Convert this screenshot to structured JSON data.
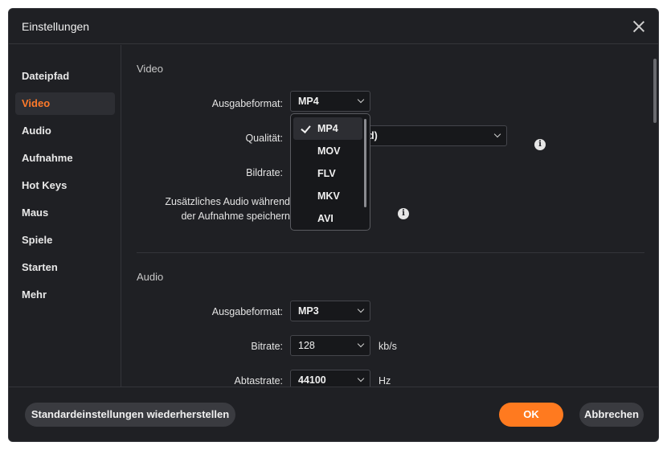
{
  "window": {
    "title": "Einstellungen"
  },
  "sidebar": {
    "items": [
      {
        "label": "Dateipfad",
        "active": false
      },
      {
        "label": "Video",
        "active": true
      },
      {
        "label": "Audio",
        "active": false
      },
      {
        "label": "Aufnahme",
        "active": false
      },
      {
        "label": "Hot Keys",
        "active": false
      },
      {
        "label": "Maus",
        "active": false
      },
      {
        "label": "Spiele",
        "active": false
      },
      {
        "label": "Starten",
        "active": false
      },
      {
        "label": "Mehr",
        "active": false
      }
    ]
  },
  "video": {
    "section_title": "Video",
    "output_format_label": "Ausgabeformat:",
    "output_format_value": "MP4",
    "quality_label": "Qualität:",
    "quality_value_visible": "d)",
    "bitrate_label": "Bildrate:",
    "extra_audio_label_line1": "Zusätzliches Audio während",
    "extra_audio_label_line2": "der Aufnahme speichern",
    "info_glyph": "i"
  },
  "format_dropdown": {
    "options": [
      "MP4",
      "MOV",
      "FLV",
      "MKV",
      "AVI"
    ],
    "selected": "MP4"
  },
  "audio": {
    "section_title": "Audio",
    "output_format_label": "Ausgabeformat:",
    "output_format_value": "MP3",
    "bitrate_label": "Bitrate:",
    "bitrate_value": "128",
    "bitrate_unit": "kb/s",
    "samplerate_label": "Abtastrate:",
    "samplerate_value": "44100",
    "samplerate_unit": "Hz"
  },
  "footer": {
    "reset_label": "Standardeinstellungen wiederherstellen",
    "ok_label": "OK",
    "cancel_label": "Abbrechen"
  },
  "colors": {
    "accent": "#ff7a1f",
    "background": "#1f2024"
  }
}
